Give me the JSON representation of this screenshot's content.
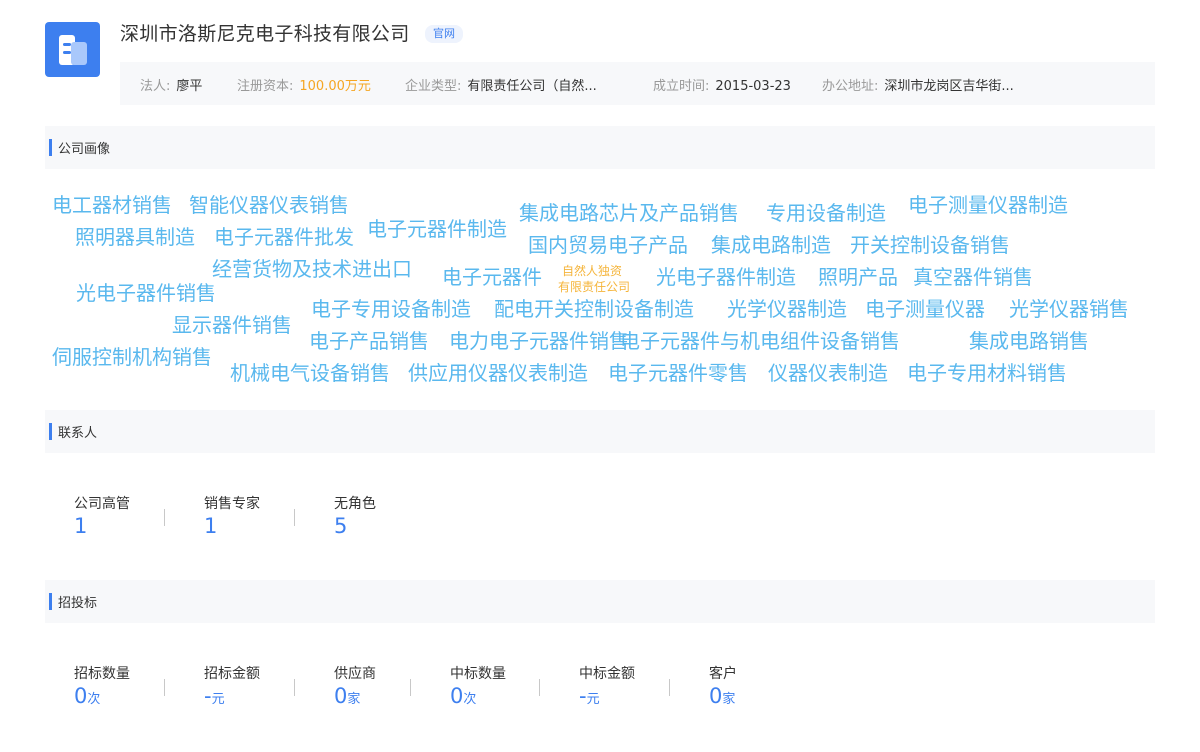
{
  "company": {
    "name": "深圳市洛斯尼克电子科技有限公司",
    "badge": "官网"
  },
  "info": {
    "legal_rep": {
      "label": "法人:",
      "value": "廖平"
    },
    "capital": {
      "label": "注册资本:",
      "value": "100.00万元"
    },
    "type": {
      "label": "企业类型:",
      "value": "有限责任公司（自然..."
    },
    "founded": {
      "label": "成立时间:",
      "value": "2015-03-23"
    },
    "address": {
      "label": "办公地址:",
      "value": "深圳市龙岗区吉华街..."
    }
  },
  "sections": {
    "profile": "公司画像",
    "contacts": "联系人",
    "bidding": "招投标"
  },
  "tags": [
    "电工器材销售",
    "智能仪器仪表销售",
    "集成电路芯片及产品销售",
    "专用设备制造",
    "电子测量仪器制造",
    "照明器具制造",
    "电子元器件批发",
    "电子元器件制造",
    "国内贸易电子产品",
    "集成电路制造",
    "开关控制设备销售",
    "经营货物及技术进出口",
    "电子元器件",
    "光电子器件制造",
    "照明产品",
    "真空器件销售",
    "光电子器件销售",
    "电子专用设备制造",
    "配电开关控制设备制造",
    "光学仪器制造",
    "电子测量仪器",
    "光学仪器销售",
    "显示器件销售",
    "电子产品销售",
    "电力电子元器件销售",
    "电子元器件与机电组件设备销售",
    "集成电路销售",
    "伺服控制机构销售",
    "机械电气设备销售",
    "供应用仪器仪表制造",
    "电子元器件零售",
    "仪器仪表制造",
    "电子专用材料销售"
  ],
  "small_tags": [
    "自然人独资",
    "有限责任公司"
  ],
  "contacts": [
    {
      "label": "公司高管",
      "value": "1"
    },
    {
      "label": "销售专家",
      "value": "1"
    },
    {
      "label": "无角色",
      "value": "5"
    }
  ],
  "bids": [
    {
      "label": "招标数量",
      "value": "0",
      "unit": "次"
    },
    {
      "label": "招标金额",
      "value": "-",
      "unit": "元"
    },
    {
      "label": "供应商",
      "value": "0",
      "unit": "家"
    },
    {
      "label": "中标数量",
      "value": "0",
      "unit": "次"
    },
    {
      "label": "中标金额",
      "value": "-",
      "unit": "元"
    },
    {
      "label": "客户",
      "value": "0",
      "unit": "家"
    }
  ],
  "colors": {
    "accent": "#3d7fef",
    "tag": "#5ab8ee",
    "orange": "#f5a623"
  }
}
